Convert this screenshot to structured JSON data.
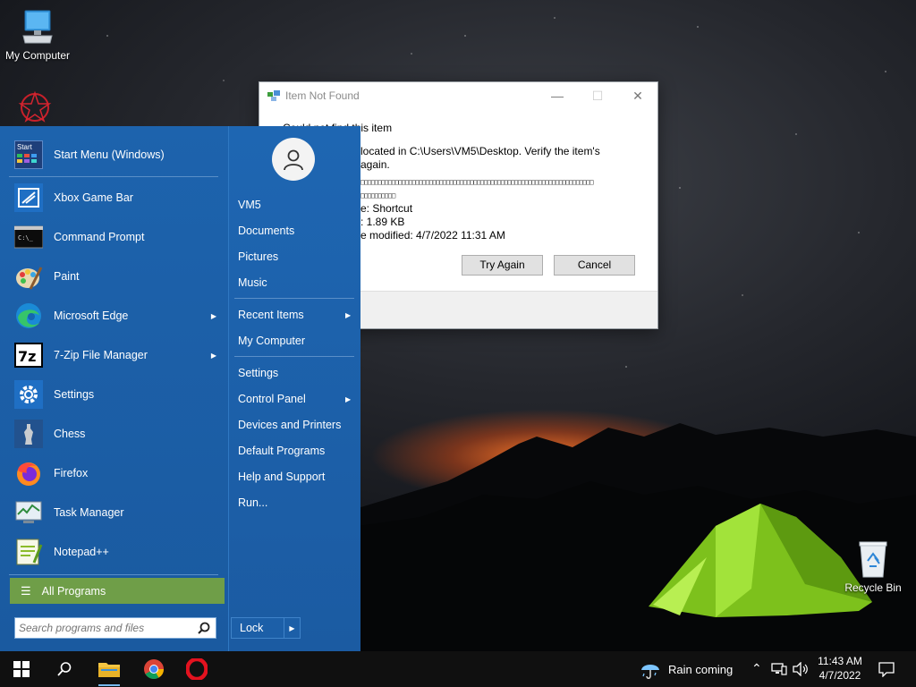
{
  "desktop": {
    "icons": {
      "my_computer": "My Computer",
      "recycle_bin": "Recycle Bin"
    }
  },
  "dialog": {
    "title": "Item Not Found",
    "heading": "Could not find this item",
    "line1": "located in C:\\Users\\VM5\\Desktop. Verify the item's",
    "line2": "again.",
    "garbled1": "□□□□□□□□□□□□□□□□□□□□□□□□□□□□□□□□□□□□□□□□□□□□□□□□□□□□□□□□□□□□□□□□□□□□",
    "garbled2": "□□□□□□□□□□",
    "type_line": "e: Shortcut",
    "size_line": ": 1.89 KB",
    "date_line": "e modified: 4/7/2022 11:31 AM",
    "try_again": "Try Again",
    "cancel": "Cancel"
  },
  "start_menu": {
    "left_items": [
      {
        "label": "Start Menu (Windows)",
        "icon": "start-menu-icon"
      },
      {
        "label": "Xbox Game Bar",
        "icon": "xbox-game-bar-icon"
      },
      {
        "label": "Command Prompt",
        "icon": "command-prompt-icon"
      },
      {
        "label": "Paint",
        "icon": "paint-icon"
      },
      {
        "label": "Microsoft Edge",
        "icon": "edge-icon",
        "submenu": true
      },
      {
        "label": "7-Zip File Manager",
        "icon": "7zip-icon",
        "submenu": true
      },
      {
        "label": "Settings",
        "icon": "settings-gear-icon"
      },
      {
        "label": "Chess",
        "icon": "chess-icon"
      },
      {
        "label": "Firefox",
        "icon": "firefox-icon"
      },
      {
        "label": "Task Manager",
        "icon": "task-manager-icon"
      },
      {
        "label": "Notepad++",
        "icon": "notepadpp-icon"
      }
    ],
    "start_icon_text": "Start",
    "all_programs": "All Programs",
    "search_placeholder": "Search programs and files",
    "right_items": [
      {
        "label": "VM5"
      },
      {
        "label": "Documents"
      },
      {
        "label": "Pictures"
      },
      {
        "label": "Music"
      },
      {
        "label": "Recent Items",
        "submenu": true
      },
      {
        "label": "My Computer"
      },
      {
        "label": "Settings"
      },
      {
        "label": "Control Panel",
        "submenu": true
      },
      {
        "label": "Devices and Printers"
      },
      {
        "label": "Default Programs"
      },
      {
        "label": "Help and Support"
      },
      {
        "label": "Run..."
      }
    ],
    "lock": "Lock"
  },
  "taskbar": {
    "weather": "Rain coming",
    "time": "11:43 AM",
    "date": "4/7/2022"
  },
  "colors": {
    "start_menu_blue": "#1b5fa8",
    "all_programs_green": "#6f9e48",
    "taskbar": "#101010"
  }
}
